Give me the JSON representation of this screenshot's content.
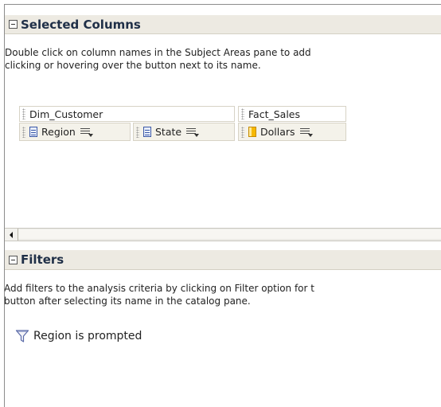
{
  "selected_columns": {
    "title": "Selected Columns",
    "help_line1": "Double click on column names in the Subject Areas pane to add",
    "help_line2": "clicking or hovering over the button next to its name.",
    "groups": [
      {
        "name": "Dim_Customer",
        "columns": [
          {
            "label": "Region",
            "icon": "attribute-column-icon"
          },
          {
            "label": "State",
            "icon": "attribute-column-icon"
          }
        ]
      },
      {
        "name": "Fact_Sales",
        "columns": [
          {
            "label": "Dollars",
            "icon": "measure-column-icon"
          }
        ]
      }
    ]
  },
  "filters": {
    "title": "Filters",
    "help_line1": "Add filters to the analysis criteria by clicking on Filter option for t",
    "help_line2": "button after selecting its name in the catalog pane.",
    "items": [
      {
        "label": "Region is prompted",
        "icon": "funnel-icon"
      }
    ]
  },
  "colors": {
    "header_bg": "#edeae2",
    "header_text": "#1f2f47",
    "attribute_icon": "#3b58a6",
    "measure_icon": "#f6b800"
  }
}
